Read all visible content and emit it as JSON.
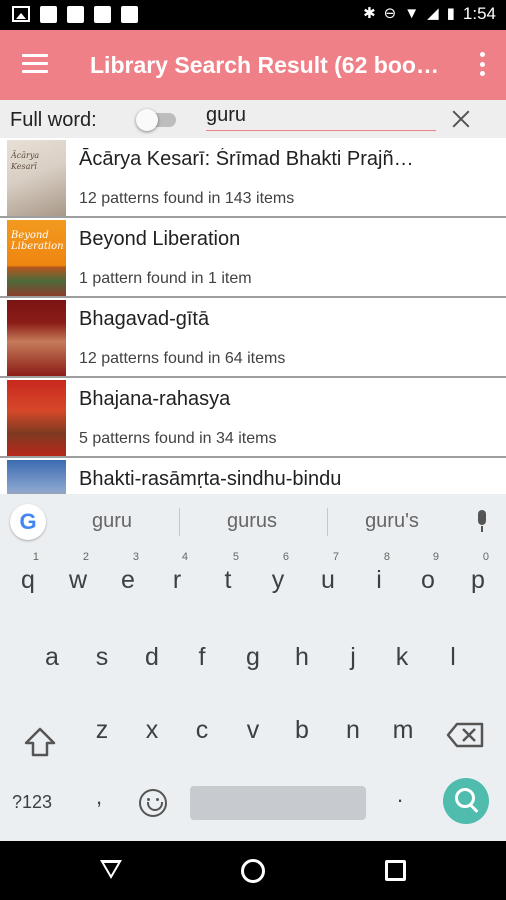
{
  "status_bar": {
    "time": "1:54",
    "icons": [
      "image-icon",
      "notification-icon",
      "notification-icon",
      "notification-icon",
      "notification-icon",
      "bluetooth-icon",
      "dnd-icon",
      "wifi-icon",
      "signal-icon",
      "battery-icon"
    ]
  },
  "app_bar": {
    "title": "Library Search Result (62 book…",
    "menu_icon": "menu-icon",
    "overflow_icon": "more-vert-icon",
    "background": "#f08088"
  },
  "search": {
    "full_word_label": "Full word:",
    "full_word_enabled": false,
    "query": "guru"
  },
  "results": [
    {
      "title": "Ācārya Kesarī: Śrīmad Bhakti Prajñ…",
      "summary": "12 patterns found in 143 items",
      "cover_text": "Ācārya Kesarī"
    },
    {
      "title": "Beyond Liberation",
      "summary": "1 pattern found in 1 item",
      "cover_text": "Beyond Liberation"
    },
    {
      "title": "Bhagavad-gītā",
      "summary": "12 patterns found in 64 items",
      "cover_text": ""
    },
    {
      "title": "Bhajana-rahasya",
      "summary": "5 patterns found in 34 items",
      "cover_text": ""
    },
    {
      "title": "Bhakti-rasāmṛta-sindhu-bindu",
      "summary": "",
      "cover_text": ""
    }
  ],
  "keyboard": {
    "suggestions": [
      "guru",
      "gurus",
      "guru's"
    ],
    "row1": [
      "q",
      "w",
      "e",
      "r",
      "t",
      "y",
      "u",
      "i",
      "o",
      "p"
    ],
    "row1_hints": [
      "1",
      "2",
      "3",
      "4",
      "5",
      "6",
      "7",
      "8",
      "9",
      "0"
    ],
    "row2": [
      "a",
      "s",
      "d",
      "f",
      "g",
      "h",
      "j",
      "k",
      "l"
    ],
    "row3": [
      "z",
      "x",
      "c",
      "v",
      "b",
      "n",
      "m"
    ],
    "symbols_label": "?123",
    "comma": ",",
    "period": ".",
    "accent": "#4fbcae"
  }
}
